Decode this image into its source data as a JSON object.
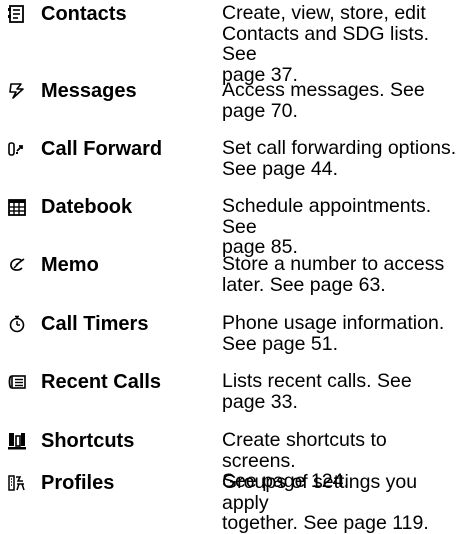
{
  "items": [
    {
      "icon": "contacts-icon",
      "name": "Contacts",
      "desc": [
        "Create, view, store, edit",
        "Contacts and SDG lists. See",
        "page 37."
      ]
    },
    {
      "icon": "messages-icon",
      "name": "Messages",
      "desc": [
        "Access messages. See",
        "page 70."
      ]
    },
    {
      "icon": "call-forward-icon",
      "name": "Call Forward",
      "desc": [
        "Set call forwarding options.",
        "See page 44."
      ]
    },
    {
      "icon": "datebook-icon",
      "name": "Datebook",
      "desc": [
        "Schedule appointments. See",
        "page 85."
      ]
    },
    {
      "icon": "memo-icon",
      "name": "Memo",
      "desc": [
        "Store a number to access",
        "later. See page 63."
      ]
    },
    {
      "icon": "call-timers-icon",
      "name": "Call Timers",
      "desc": [
        "Phone usage information.",
        "See page 51."
      ]
    },
    {
      "icon": "recent-calls-icon",
      "name": "Recent Calls",
      "desc": [
        "Lists recent calls. See",
        "page 33."
      ]
    },
    {
      "icon": "shortcuts-icon",
      "name": "Shortcuts",
      "desc": [
        "Create shortcuts to screens.",
        "See page 124."
      ]
    },
    {
      "icon": "profiles-icon",
      "name": "Profiles",
      "desc": [
        "Groups of settings you apply",
        "together. See page 119."
      ]
    }
  ]
}
